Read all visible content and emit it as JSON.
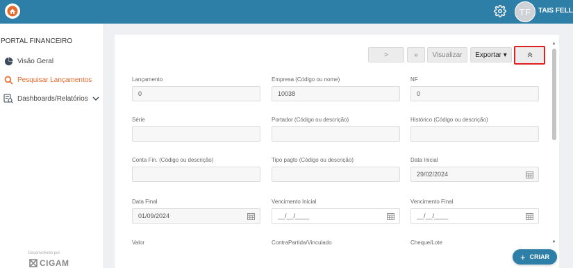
{
  "header": {
    "user_initials": "TF",
    "user_name": "TAIS FELLES"
  },
  "sidebar": {
    "title": "PORTAL FINANCEIRO",
    "items": [
      {
        "label": "Visão Geral",
        "icon": "pie-chart-icon"
      },
      {
        "label": "Pesquisar Lançamentos",
        "icon": "search-icon",
        "active": true
      },
      {
        "label": "Dashboards/Relatórios",
        "icon": "report-icon"
      }
    ],
    "powered_by": "Desenvolvido por",
    "brand": "CIGAM"
  },
  "toolbar": {
    "next": ">",
    "last": "»",
    "visualize": "Visualizar",
    "export": "Exportar ▾",
    "collapse": "«"
  },
  "form": {
    "lancamento": {
      "label": "Lançamento",
      "value": "0"
    },
    "empresa": {
      "label": "Empresa (Código ou nome)",
      "value": "10038"
    },
    "nf": {
      "label": "NF",
      "value": "0"
    },
    "serie": {
      "label": "Série",
      "value": ""
    },
    "portador": {
      "label": "Portador (Código ou descrição)",
      "value": ""
    },
    "historico": {
      "label": "Histórico (Código ou descrição)",
      "value": ""
    },
    "conta_fin": {
      "label": "Conta Fin. (Código ou descrição)",
      "value": ""
    },
    "tipo_pagto": {
      "label": "Tipo pagto (Código ou descrição)",
      "value": ""
    },
    "data_inicial": {
      "label": "Data Inicial",
      "value": "29/02/2024"
    },
    "data_final": {
      "label": "Data Final",
      "value": "01/09/2024"
    },
    "vencimento_inicial": {
      "label": "Vencimento Inicial",
      "value": "__/__/____"
    },
    "vencimento_final": {
      "label": "Vencimento Final",
      "value": "__/__/____"
    },
    "valor": {
      "label": "Valor"
    },
    "contrapartida": {
      "label": "ContraPartida/Vinculado"
    },
    "cheque_lote": {
      "label": "Cheque/Lote"
    }
  },
  "fab": {
    "label": "CRIAR"
  },
  "colors": {
    "primary": "#2e7fa8",
    "accent": "#e86a2c",
    "highlight": "#e02020"
  }
}
